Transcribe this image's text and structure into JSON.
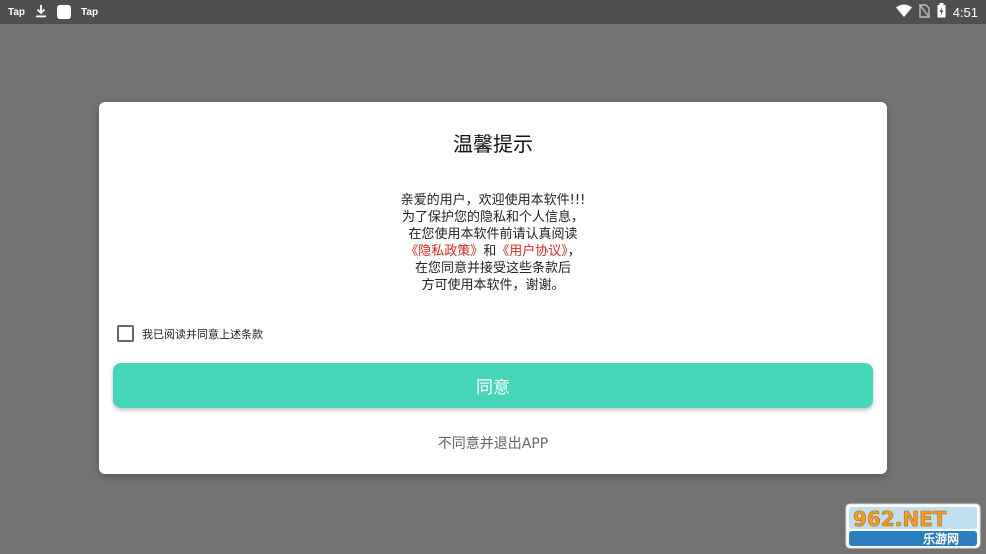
{
  "statusbar": {
    "left_app1": "Tap",
    "left_app2": "Tap",
    "time": "4:51"
  },
  "dialog": {
    "title": "温馨提示",
    "line1": "亲爱的用户，欢迎使用本软件!!!",
    "line2": "为了保护您的隐私和个人信息，",
    "line3": "在您使用本软件前请认真阅读",
    "privacy_link": "《隐私政策》",
    "and_text": "和",
    "user_link": "《用户协议》",
    "comma": "，",
    "line5": "在您同意并接受这些条款后",
    "line6": "方可使用本软件，谢谢。",
    "checkbox_label": "我已阅读并同意上述条款",
    "checkbox_checked": false,
    "agree_button": "同意",
    "exit_link": "不同意并退出APP"
  },
  "watermark": {
    "top": "962.NET",
    "bottom": "乐游网"
  },
  "colors": {
    "accent": "#45d6b9",
    "link": "#e0241e",
    "overlay": "#737373"
  }
}
